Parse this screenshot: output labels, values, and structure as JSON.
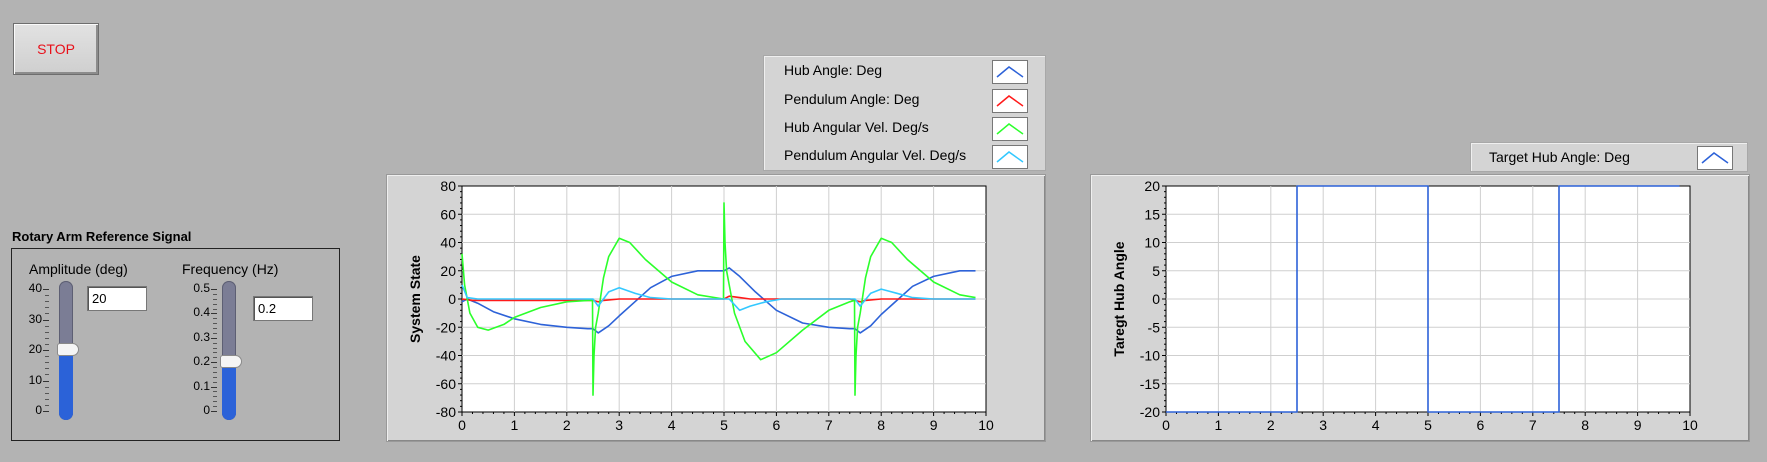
{
  "stop_button": {
    "label": "STOP"
  },
  "reference_signal": {
    "title": "Rotary Arm Reference Signal",
    "amplitude": {
      "label": "Amplitude (deg)",
      "value": "20",
      "slider_value": 20,
      "scale_min": 0,
      "scale_max": 40,
      "ticks": [
        "40",
        "30",
        "20",
        "10",
        "0"
      ]
    },
    "frequency": {
      "label": "Frequency (Hz)",
      "value": "0.2",
      "slider_value": 0.2,
      "scale_min": 0,
      "scale_max": 0.5,
      "ticks": [
        "0.5",
        "0.4",
        "0.3",
        "0.2",
        "0.1",
        "0"
      ]
    }
  },
  "colors": {
    "hub_angle": "#2d62d8",
    "pendulum_angle": "#ff1a1a",
    "hub_velocity": "#2bff2b",
    "pendulum_velocity": "#33c8ff",
    "target_hub_angle": "#2d62d8",
    "slider_fill": "#2b62d8",
    "stop_text": "#e8101a"
  },
  "legend_system": {
    "items": [
      {
        "label": "Hub Angle: Deg",
        "color": "#2d62d8"
      },
      {
        "label": "Pendulum Angle: Deg",
        "color": "#ff1a1a"
      },
      {
        "label": "Hub Angular Vel. Deg/s",
        "color": "#2bff2b"
      },
      {
        "label": "Pendulum Angular Vel. Deg/s",
        "color": "#33c8ff"
      }
    ]
  },
  "legend_target": {
    "items": [
      {
        "label": "Target Hub Angle: Deg",
        "color": "#2d62d8"
      }
    ]
  },
  "chart_data": [
    {
      "type": "line",
      "ylabel": "System State",
      "xlim": [
        0,
        10
      ],
      "ylim": [
        -80,
        80
      ],
      "xticks": [
        "0",
        "1",
        "2",
        "3",
        "4",
        "5",
        "6",
        "7",
        "8",
        "9",
        "10"
      ],
      "yticks": [
        "80",
        "60",
        "40",
        "20",
        "0",
        "-20",
        "-40",
        "-60",
        "-80"
      ],
      "grid": true,
      "series": [
        {
          "name": "Hub Angle: Deg",
          "color": "#2d62d8",
          "x": [
            0,
            0.1,
            0.3,
            0.6,
            1,
            1.5,
            2,
            2.4,
            2.5,
            2.6,
            2.8,
            3,
            3.3,
            3.6,
            4,
            4.5,
            5,
            5.1,
            5.3,
            5.6,
            6,
            6.5,
            7,
            7.4,
            7.5,
            7.6,
            7.8,
            8,
            8.3,
            8.6,
            9,
            9.5,
            9.8
          ],
          "y": [
            -2,
            0,
            -3,
            -9,
            -14,
            -18,
            -20,
            -21,
            -21,
            -24,
            -19,
            -12,
            -2,
            8,
            16,
            20,
            20,
            22,
            16,
            5,
            -8,
            -17,
            -20,
            -21,
            -21,
            -24,
            -19,
            -11,
            -1,
            9,
            16,
            20,
            20
          ]
        },
        {
          "name": "Pendulum Angle: Deg",
          "color": "#ff1a1a",
          "x": [
            0,
            0.2,
            0.5,
            1,
            1.5,
            2,
            2.4,
            2.5,
            2.6,
            2.7,
            3,
            3.5,
            4,
            4.5,
            5,
            5.1,
            5.3,
            5.5,
            6,
            6.5,
            7,
            7.4,
            7.5,
            7.6,
            7.7,
            8,
            8.5,
            9,
            9.5,
            9.8
          ],
          "y": [
            0,
            -1,
            -1,
            -1,
            -1,
            -1,
            -1,
            -1,
            -2,
            -1,
            0,
            0,
            0,
            0,
            0,
            2,
            1,
            0,
            0,
            0,
            0,
            0,
            -1,
            -2,
            -1,
            0,
            0,
            0,
            0,
            0
          ]
        },
        {
          "name": "Hub Angular Vel. Deg/s",
          "color": "#2bff2b",
          "x": [
            0,
            0.05,
            0.15,
            0.3,
            0.5,
            0.8,
            1,
            1.5,
            2,
            2.4,
            2.49,
            2.5,
            2.52,
            2.55,
            2.6,
            2.7,
            2.8,
            3,
            3.2,
            3.5,
            4,
            4.5,
            4.99,
            5,
            5.02,
            5.05,
            5.1,
            5.2,
            5.4,
            5.7,
            6,
            6.5,
            7,
            7.4,
            7.49,
            7.5,
            7.52,
            7.55,
            7.6,
            7.7,
            7.8,
            8,
            8.2,
            8.5,
            9,
            9.5,
            9.8
          ],
          "y": [
            32,
            10,
            -10,
            -20,
            -22,
            -18,
            -13,
            -6,
            -2,
            -1,
            -1,
            -68,
            -40,
            -20,
            -10,
            15,
            30,
            43,
            40,
            28,
            12,
            3,
            0,
            68,
            40,
            20,
            10,
            -10,
            -30,
            -43,
            -38,
            -22,
            -8,
            -2,
            -1,
            -68,
            -40,
            -20,
            -10,
            15,
            30,
            43,
            40,
            28,
            12,
            3,
            1
          ]
        },
        {
          "name": "Pendulum Angular Vel. Deg/s",
          "color": "#33c8ff",
          "x": [
            0,
            0.1,
            0.3,
            0.6,
            1,
            2,
            2.5,
            2.6,
            2.8,
            3,
            3.3,
            3.6,
            4,
            4.5,
            5,
            5.1,
            5.3,
            5.5,
            5.8,
            6.1,
            6.5,
            7,
            7.5,
            7.6,
            7.8,
            8,
            8.3,
            8.6,
            9,
            9.5,
            9.8
          ],
          "y": [
            10,
            1,
            0,
            0,
            0,
            0,
            0,
            -5,
            5,
            8,
            4,
            1,
            0,
            0,
            0,
            0,
            -8,
            -5,
            -2,
            0,
            0,
            0,
            0,
            -5,
            4,
            7,
            4,
            1,
            0,
            0,
            0
          ]
        }
      ]
    },
    {
      "type": "line",
      "ylabel": "Taregt Hub Angle",
      "xlim": [
        0,
        10
      ],
      "ylim": [
        -20,
        20
      ],
      "xticks": [
        "0",
        "1",
        "2",
        "3",
        "4",
        "5",
        "6",
        "7",
        "8",
        "9",
        "10"
      ],
      "yticks": [
        "20",
        "15",
        "10",
        "5",
        "0",
        "-5",
        "-10",
        "-15",
        "-20"
      ],
      "grid": true,
      "series": [
        {
          "name": "Target Hub Angle: Deg",
          "color": "#2d62d8",
          "x": [
            0,
            2.5,
            2.5,
            5,
            5,
            7.5,
            7.5,
            9.8
          ],
          "y": [
            -20,
            -20,
            20,
            20,
            -20,
            -20,
            20,
            20
          ]
        }
      ]
    }
  ]
}
